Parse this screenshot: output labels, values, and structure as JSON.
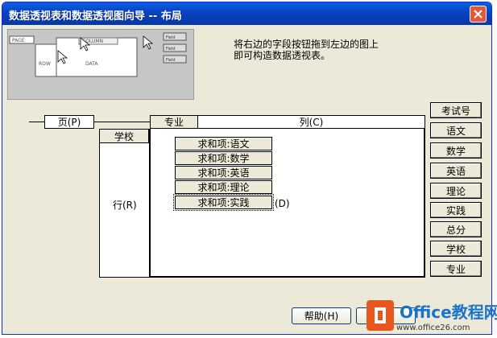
{
  "window": {
    "title": "数据透视表和数据透视图向导 -- 布局",
    "close_icon": "close-icon"
  },
  "preview": {
    "row_label": "ROW",
    "col_label": "COLUMN",
    "page_label": "PAGE",
    "data_label": "DATA",
    "btn1": "Field",
    "btn2": "Field",
    "btn3": "Field"
  },
  "instructions": {
    "line1": "将右边的字段按钮拖到左边的图上",
    "line2": "即可构造数据透视表。"
  },
  "layout": {
    "page_label": "页(P)",
    "column_label": "列(C)",
    "row_label": "行(R)",
    "data_label": "(D)",
    "column_field": "专业",
    "row_field": "学校",
    "data_fields": [
      "求和项:语文",
      "求和项:数学",
      "求和项:英语",
      "求和项:理论",
      "求和项:实践"
    ]
  },
  "available_fields": [
    "考试号",
    "语文",
    "数学",
    "英语",
    "理论",
    "实践",
    "总分",
    "学校",
    "专业"
  ],
  "buttons": {
    "help": "帮助(H)"
  },
  "watermark": {
    "text": "Office教程网",
    "url": "www.office26.com"
  }
}
